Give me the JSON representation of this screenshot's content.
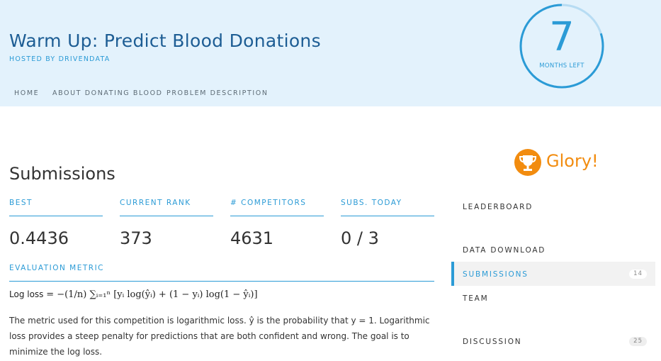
{
  "header": {
    "title": "Warm Up: Predict Blood Donations",
    "hosted_by": "HOSTED BY DRIVENDATA",
    "nav": [
      "HOME",
      "ABOUT DONATING BLOOD",
      "PROBLEM DESCRIPTION"
    ]
  },
  "timer": {
    "value": "7",
    "label": "MONTHS LEFT",
    "progress": 0.8,
    "color": "#2b9bd6"
  },
  "submissions": {
    "title": "Submissions",
    "stats": [
      {
        "label": "BEST",
        "value": "0.4436"
      },
      {
        "label": "CURRENT RANK",
        "value": "373"
      },
      {
        "label": "# COMPETITORS",
        "value": "4631"
      },
      {
        "label": "SUBS. TODAY",
        "value": "0 / 3"
      }
    ],
    "evaluation_metric": {
      "label": "EVALUATION METRIC",
      "formula_prefix": "Log loss",
      "formula": "= −(1/n) ∑ᵢ₌₁ⁿ [yᵢ log(ŷᵢ) + (1 − yᵢ) log(1 − ŷᵢ)]",
      "description": "The metric used for this competition is logarithmic loss. ŷ is the probability that y = 1. Logarithmic loss provides a steep penalty for predictions that are both confident and wrong. The goal is to minimize the log loss."
    }
  },
  "sidebar": {
    "prize_icon": "trophy-icon",
    "prize": "Glory!",
    "prize_color": "#f28c0f",
    "items": [
      {
        "label": "LEADERBOARD",
        "badge": null
      },
      {
        "label": "DATA DOWNLOAD",
        "badge": null
      },
      {
        "label": "SUBMISSIONS",
        "badge": "14"
      },
      {
        "label": "TEAM",
        "badge": null
      },
      {
        "label": "DISCUSSION",
        "badge": "25"
      }
    ],
    "active_item": "SUBMISSIONS"
  }
}
